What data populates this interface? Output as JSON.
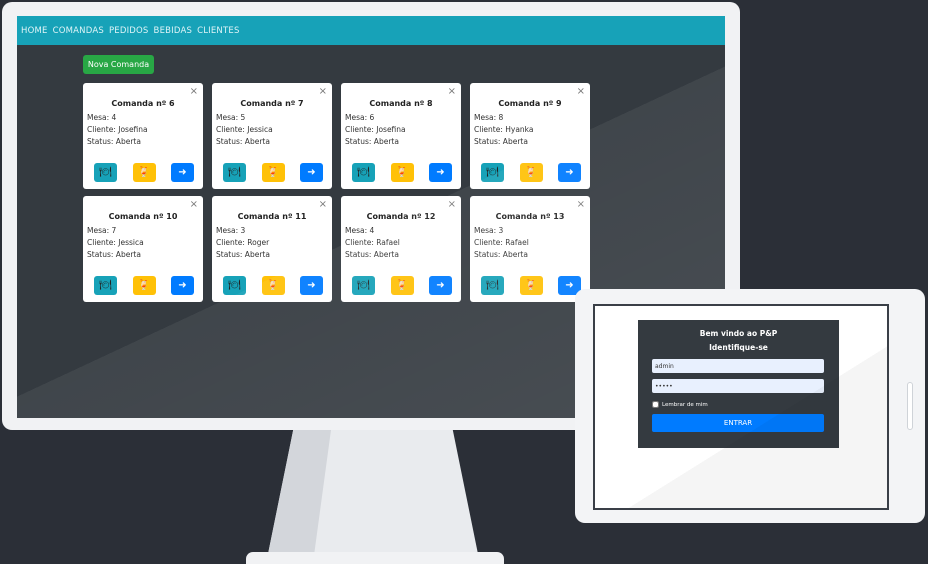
{
  "nav": {
    "items": [
      "HOME",
      "COMANDAS",
      "PEDIDOS",
      "BEBIDAS",
      "CLIENTES"
    ]
  },
  "nova_comanda_label": "Nova Comanda",
  "close_glyph": "×",
  "icons": {
    "food": "🍽",
    "drink": "🍹",
    "forward": "➜"
  },
  "cards": [
    {
      "title": "Comanda nº 6",
      "mesa": "Mesa: 4",
      "cliente": "Cliente: Josefina",
      "status": "Status: Aberta"
    },
    {
      "title": "Comanda nº 7",
      "mesa": "Mesa: 5",
      "cliente": "Cliente: Jessica",
      "status": "Status: Aberta"
    },
    {
      "title": "Comanda nº 8",
      "mesa": "Mesa: 6",
      "cliente": "Cliente: Josefina",
      "status": "Status: Aberta"
    },
    {
      "title": "Comanda nº 9",
      "mesa": "Mesa: 8",
      "cliente": "Cliente: Hyanka",
      "status": "Status: Aberta"
    },
    {
      "title": "Comanda nº 10",
      "mesa": "Mesa: 7",
      "cliente": "Cliente: Jessica",
      "status": "Status: Aberta"
    },
    {
      "title": "Comanda nº 11",
      "mesa": "Mesa: 3",
      "cliente": "Cliente: Roger",
      "status": "Status: Aberta"
    },
    {
      "title": "Comanda nº 12",
      "mesa": "Mesa: 4",
      "cliente": "Cliente: Rafael",
      "status": "Status: Aberta"
    },
    {
      "title": "Comanda nº 13",
      "mesa": "Mesa: 3",
      "cliente": "Cliente: Rafael",
      "status": "Status: Aberta"
    }
  ],
  "login": {
    "welcome": "Bem vindo ao P&P",
    "identify": "Identifique-se",
    "username_value": "admin",
    "password_value": "•••••",
    "remember_label": "Lembrar de mim",
    "submit_label": "ENTRAR"
  },
  "colors": {
    "navbar": "#17a2b8",
    "success": "#28a745",
    "primary": "#007bff",
    "warning": "#ffc107",
    "dark": "#343a40"
  }
}
